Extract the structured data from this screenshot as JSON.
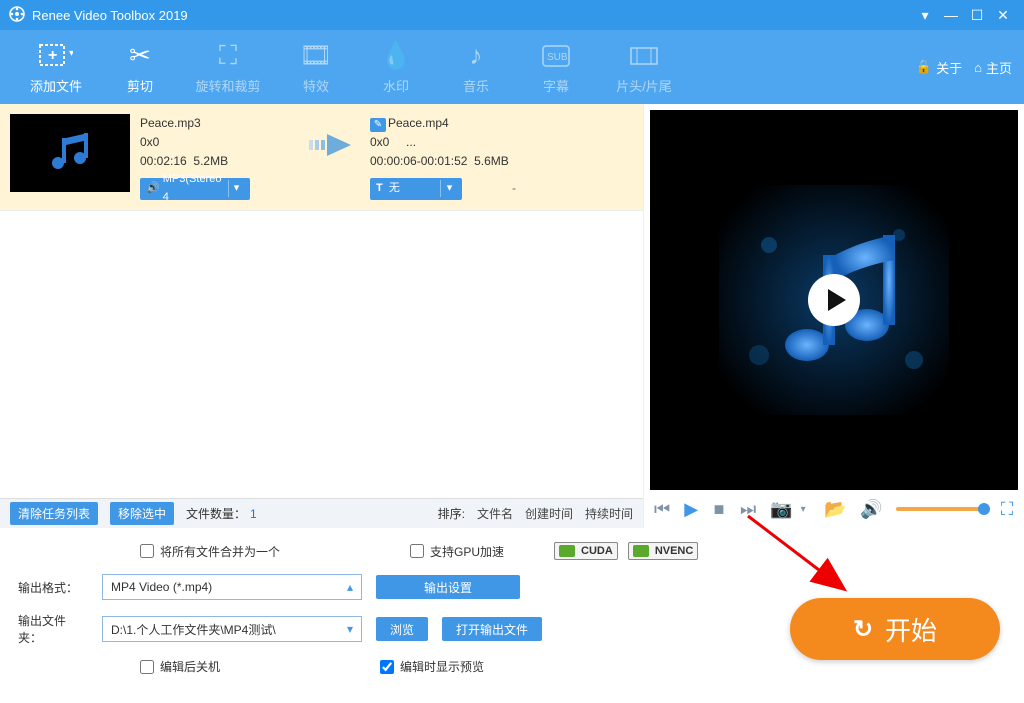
{
  "app": {
    "title": "Renee Video Toolbox 2019"
  },
  "toolbar": {
    "add_file": "添加文件",
    "cut": "剪切",
    "rotate_crop": "旋转和裁剪",
    "effects": "特效",
    "watermark": "水印",
    "music": "音乐",
    "subtitle": "字幕",
    "head_tail": "片头/片尾",
    "about": "关于",
    "home": "主页"
  },
  "filerow": {
    "src": {
      "name": "Peace.mp3",
      "resolution": "0x0",
      "duration": "00:02:16",
      "size": "5.2MB"
    },
    "dst": {
      "name": "Peace.mp4",
      "resolution": "0x0",
      "extra": "...",
      "range": "00:00:06-00:01:52",
      "size": "5.6MB"
    },
    "audio_pill": "MP3(Stereo 4",
    "subtitle_pill_prefix": "T",
    "subtitle_pill_text": "无",
    "dash": "-"
  },
  "queuebar": {
    "clear": "清除任务列表",
    "remove_sel": "移除选中",
    "count_label": "文件数量：",
    "count_value": "1",
    "sort_label": "排序:",
    "sort_name": "文件名",
    "sort_created": "创建时间",
    "sort_duration": "持续时间"
  },
  "settings": {
    "merge_all": "将所有文件合并为一个",
    "gpu_accel": "支持GPU加速",
    "cuda": "CUDA",
    "nvenc": "NVENC",
    "output_format_label": "输出格式：",
    "output_format_value": "MP4 Video (*.mp4)",
    "output_settings": "输出设置",
    "output_folder_label": "输出文件夹：",
    "output_folder_value": "D:\\1.个人工作文件夹\\MP4测试\\",
    "browse": "浏览",
    "open_output": "打开输出文件",
    "shutdown_after": "编辑后关机",
    "show_preview": "编辑时显示预览",
    "start": "开始"
  }
}
